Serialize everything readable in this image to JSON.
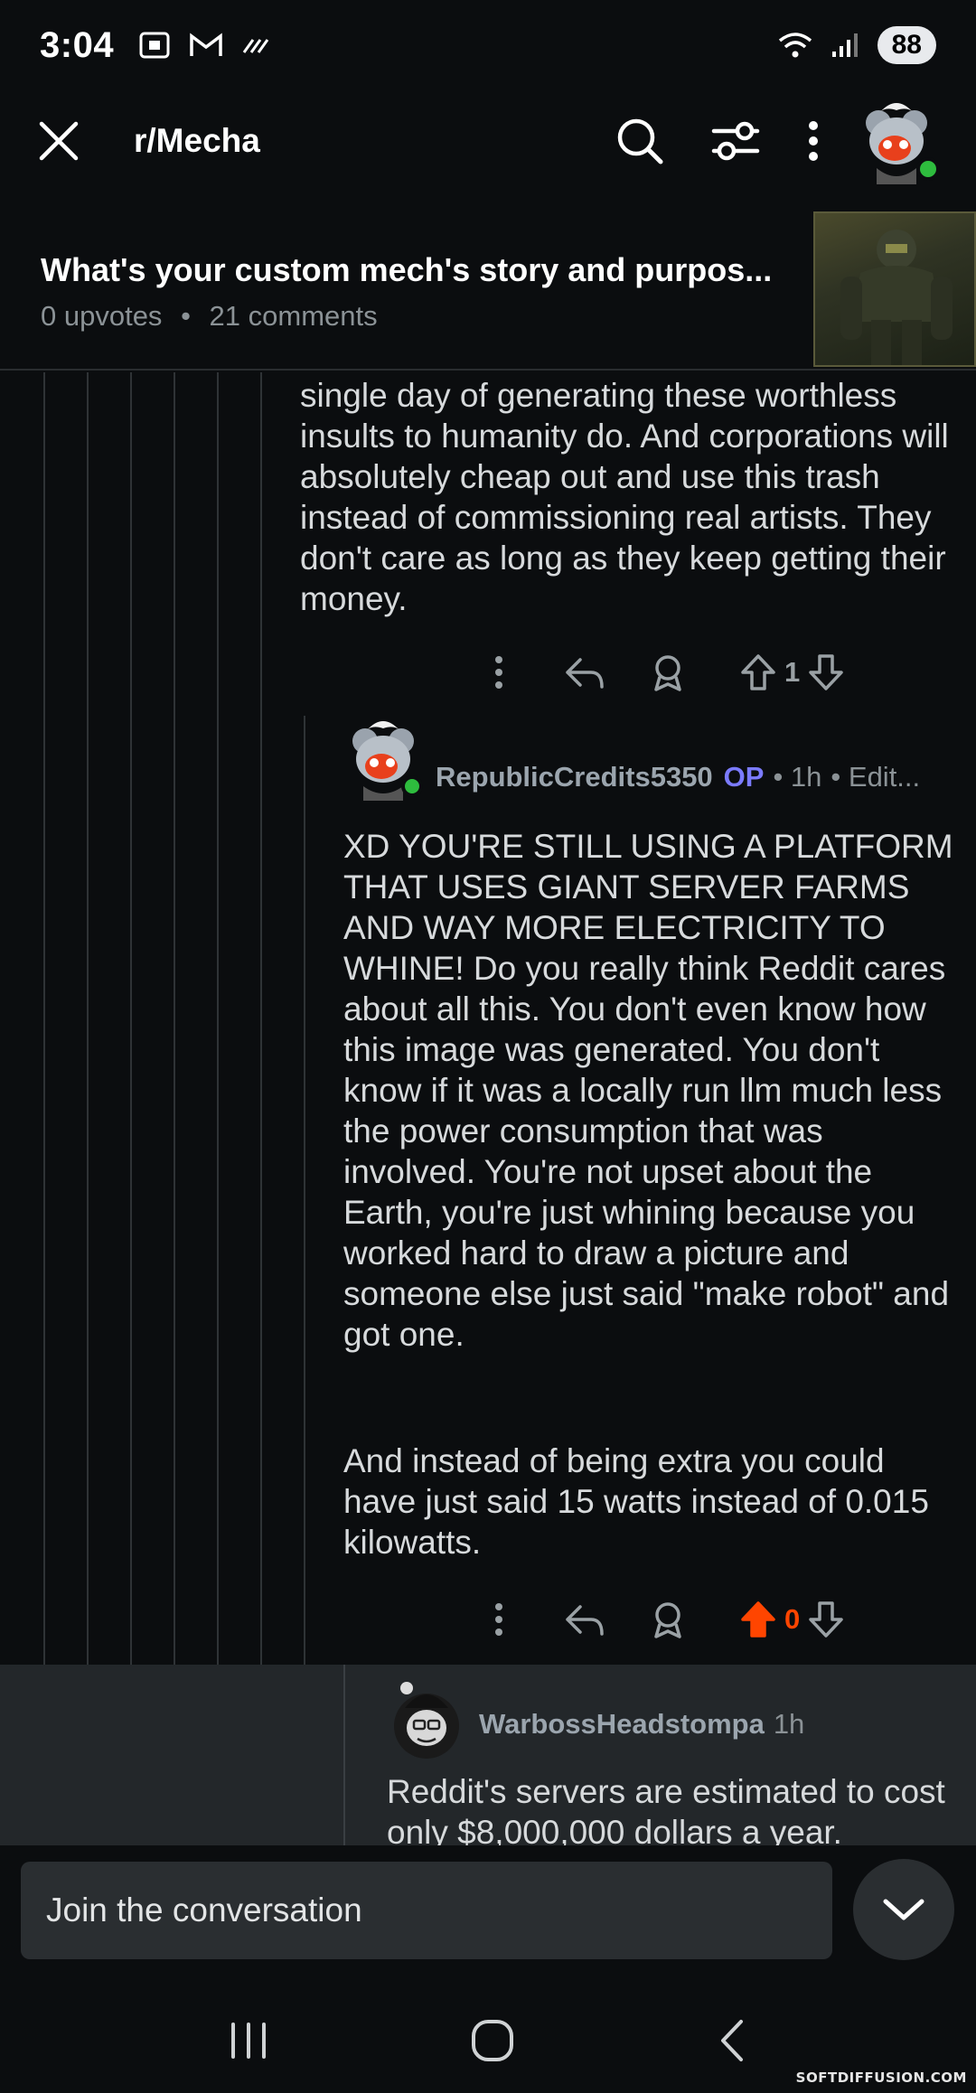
{
  "status_bar": {
    "time": "3:04",
    "battery": "88",
    "wifi_label": "6"
  },
  "header": {
    "subreddit": "r/Mecha"
  },
  "post": {
    "title": "What's your custom mech's story and purpos...",
    "upvotes": "0 upvotes",
    "separator": "•",
    "comments": "21 comments"
  },
  "parent_comment": {
    "text": "single day of generating these worthless insults to humanity do. And corporations will absolutely cheap out and use this trash instead of commissioning real artists. They don't care as long as they keep getting their money.",
    "votes": "1"
  },
  "reply_comment": {
    "author": "RepublicCredits5350",
    "op_tag": "OP",
    "time": "• 1h",
    "edited": "• Edit...",
    "paragraph1": "XD YOU'RE STILL USING A PLATFORM THAT USES GIANT SERVER FARMS AND WAY MORE ELECTRICITY TO WHINE! Do you really think Reddit cares about all this. You don't even know how this image was generated. You don't know if it was a locally run llm much less the power consumption that was involved. You're not upset about the Earth, you're just whining because you worked hard to draw a picture and someone else just said \"make robot\" and got one.",
    "paragraph2": "And instead of being extra you could have just said 15 watts instead of 0.015 kilowatts.",
    "votes": "0"
  },
  "nested_comment": {
    "author": "WarbossHeadstompa",
    "time": "1h",
    "text": "Reddit's servers are estimated to cost only $8,000,000 dollars a year."
  },
  "composer": {
    "placeholder": "Join the conversation"
  },
  "watermark": "SOFTDIFFUSION.COM",
  "colors": {
    "background": "#0b0d0f",
    "upvote_active": "#ff4500",
    "op_tag": "#7b7bff",
    "online": "#2ebc3e"
  }
}
